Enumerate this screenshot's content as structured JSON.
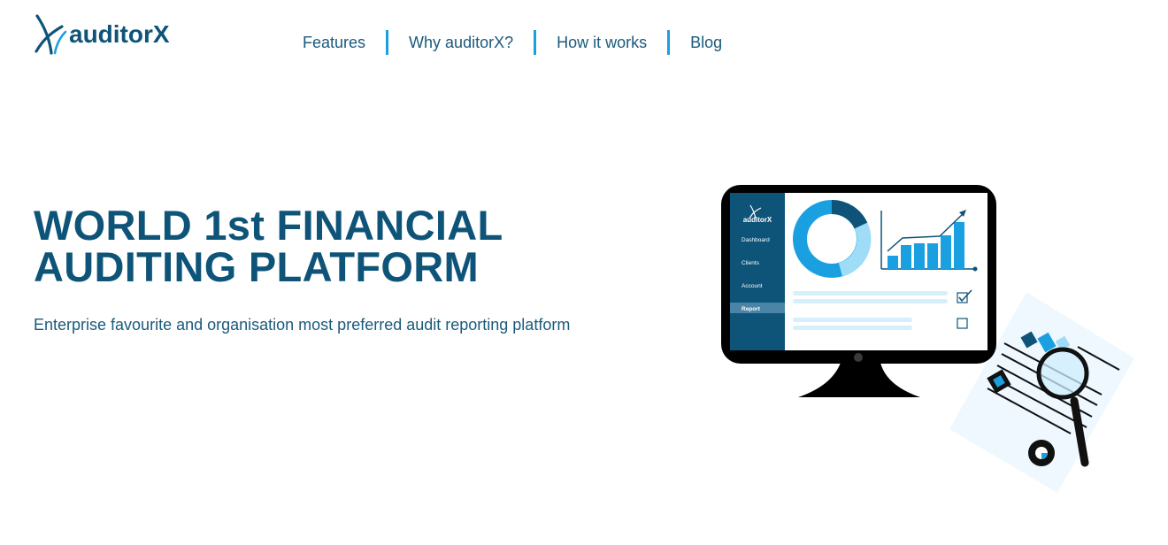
{
  "brand": {
    "name": "auditorX"
  },
  "nav": {
    "items": [
      {
        "label": "Features"
      },
      {
        "label": "Why auditorX?"
      },
      {
        "label": "How it works"
      },
      {
        "label": "Blog"
      }
    ]
  },
  "hero": {
    "title_line1": "WORLD 1st FINANCIAL",
    "title_line2": "AUDITING PLATFORM",
    "subtitle": "Enterprise favourite and organisation most preferred audit reporting platform"
  },
  "illustration": {
    "app_name": "auditorX",
    "sidebar_items": [
      "Dashboard",
      "Clients",
      "Account",
      "Report"
    ],
    "active_item": "Report"
  },
  "colors": {
    "brand": "#0e5478",
    "accent": "#1aa0e0",
    "light_blue": "#9fdcf8"
  }
}
